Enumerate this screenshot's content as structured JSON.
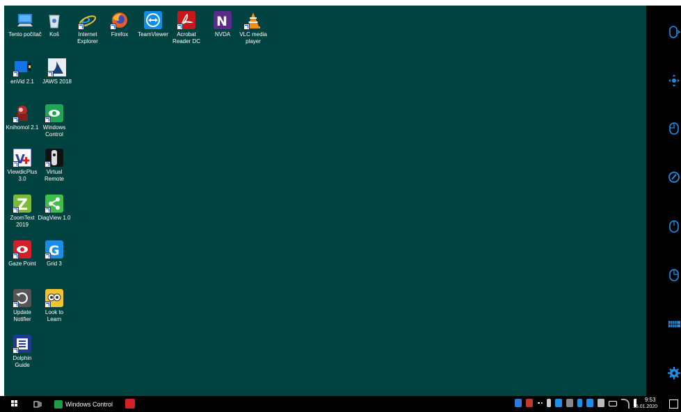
{
  "desktop": {
    "background": "#00423f",
    "icons": [
      {
        "label": "Tento počítač",
        "icon": "this-pc-icon",
        "shortcut": false
      },
      {
        "label": "Koš",
        "icon": "recycle-bin-icon",
        "shortcut": false
      },
      {
        "label": "Internet Explorer",
        "icon": "internet-explorer-icon",
        "shortcut": true
      },
      {
        "label": "Firefox",
        "icon": "firefox-icon",
        "shortcut": true
      },
      {
        "label": "TeamViewer",
        "icon": "teamviewer-icon",
        "shortcut": false
      },
      {
        "label": "Acrobat Reader DC",
        "icon": "acrobat-reader-icon",
        "shortcut": true
      },
      {
        "label": "NVDA",
        "icon": "nvda-icon",
        "shortcut": false
      },
      {
        "label": "VLC media player",
        "icon": "vlc-icon",
        "shortcut": true
      },
      {
        "label": "enVid 2.1",
        "icon": "envid-icon",
        "shortcut": true
      },
      {
        "label": "JAWS 2018",
        "icon": "jaws-icon",
        "shortcut": true
      },
      {
        "label": "Knihomol 2.1",
        "icon": "knihomol-icon",
        "shortcut": true
      },
      {
        "label": "Windows Control",
        "icon": "windows-control-icon",
        "shortcut": true
      },
      {
        "label": "ViewdicPlus 3.0",
        "icon": "viewdicplus-icon",
        "shortcut": true
      },
      {
        "label": "Virtual Remote",
        "icon": "virtual-remote-icon",
        "shortcut": true
      },
      {
        "label": "ZoomText 2019",
        "icon": "zoomtext-icon",
        "shortcut": true
      },
      {
        "label": "DiagView 1.0",
        "icon": "diagview-icon",
        "shortcut": true
      },
      {
        "label": "Gaze Point",
        "icon": "gaze-point-icon",
        "shortcut": true
      },
      {
        "label": "Grid 3",
        "icon": "grid3-icon",
        "shortcut": true
      },
      {
        "label": "Update Notifier",
        "icon": "update-notifier-icon",
        "shortcut": true
      },
      {
        "label": "Look to Learn",
        "icon": "look-to-learn-icon",
        "shortcut": true
      },
      {
        "label": "Dolphin Guide",
        "icon": "dolphin-guide-icon",
        "shortcut": true
      }
    ]
  },
  "side_panel": {
    "buttons": [
      "mouse-scroll-icon",
      "move-icon",
      "mouse-left-click-icon",
      "drag-icon",
      "mouse-double-click-icon",
      "mouse-right-click-icon",
      "keyboard-icon",
      "settings-gear-icon"
    ],
    "color": "#1e8fe8"
  },
  "taskbar": {
    "active_app": "Windows Control",
    "time": "9:53",
    "date": "15.01.2020"
  }
}
